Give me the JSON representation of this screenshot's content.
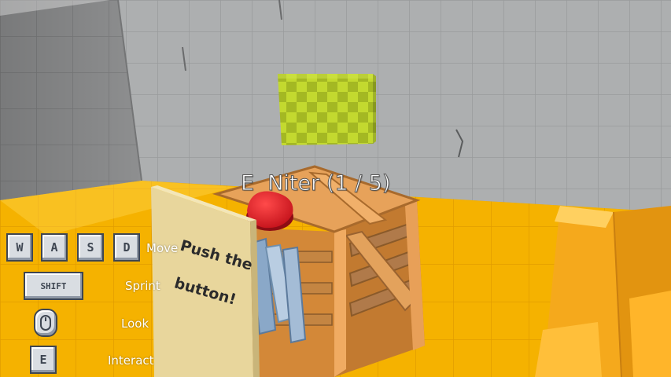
{
  "prompt": {
    "key": "E",
    "item_name": "Niter",
    "count": "(1 / 5)"
  },
  "sign": {
    "line1": "Push the",
    "line2": "button!"
  },
  "controls": {
    "move": {
      "keys": [
        "W",
        "A",
        "S",
        "D"
      ],
      "label": "Move"
    },
    "sprint": {
      "key": "SHIFT",
      "label": "Sprint"
    },
    "look": {
      "icon": "mouse-icon",
      "label": "Look"
    },
    "interact": {
      "key": "E",
      "label": "Interact"
    }
  },
  "colors": {
    "floor": "#f5b400",
    "wall": "#a8aaab",
    "crate": "#d98a3a",
    "button": "#e0202a",
    "cube": "#b4cc2a",
    "sign": "#ead9a0"
  }
}
